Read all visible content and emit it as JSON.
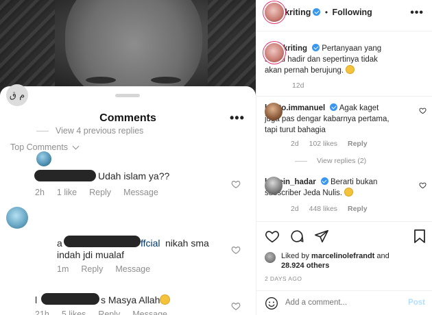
{
  "sheet": {
    "title": "Comments",
    "filter_label": "Top Comments",
    "comments": [
      {
        "avatar_text": "م ق",
        "text": "Udah islam ya??",
        "time": "2h",
        "likes": "1 like",
        "reply": "Reply",
        "message": "Message"
      },
      {
        "view_previous": "View 4 previous replies"
      },
      {
        "prefix": "a",
        "handle_tail": "ffcial",
        "text": " nikah sma",
        "text2": "indah jdi mualaf",
        "time": "1m",
        "reply": "Reply",
        "message": "Message"
      },
      {
        "prefix": "l",
        "text": "s Masya Allah",
        "time": "21h",
        "likes": "5 likes",
        "reply": "Reply",
        "message": "Message"
      }
    ]
  },
  "post": {
    "header": {
      "username": "arie_kriting",
      "separator": "•",
      "follow_label": "Following"
    },
    "caption": {
      "username": "arie_kriting",
      "text": "Pertanyaan yang selalu hadir dan sepertinya tidak akan pernah berujung.",
      "time": "12d"
    },
    "comments": [
      {
        "username": "kristo.immanuel",
        "text": "Agak kaget juga pas dengar kabarnya pertama, tapi turut bahagia",
        "time": "2d",
        "likes": "102 likes",
        "reply": "Reply"
      },
      {
        "username": "husein_hadar",
        "text": "Berarti bukan subscriber Jeda Nulis.",
        "time": "2d",
        "likes": "448 likes",
        "reply": "Reply"
      }
    ],
    "view_replies": "View replies (2)",
    "liked_by": {
      "prefix": "Liked by",
      "user": "marcelinolefrandt",
      "and": "and",
      "others": "28.924 others"
    },
    "date": "2 DAYS AGO",
    "add_comment_placeholder": "Add a comment...",
    "post_label": "Post"
  },
  "colors": {
    "verified": "#3897f0",
    "muted": "#8e8e8e",
    "post_disabled": "#b2dffc",
    "text": "#262626"
  }
}
